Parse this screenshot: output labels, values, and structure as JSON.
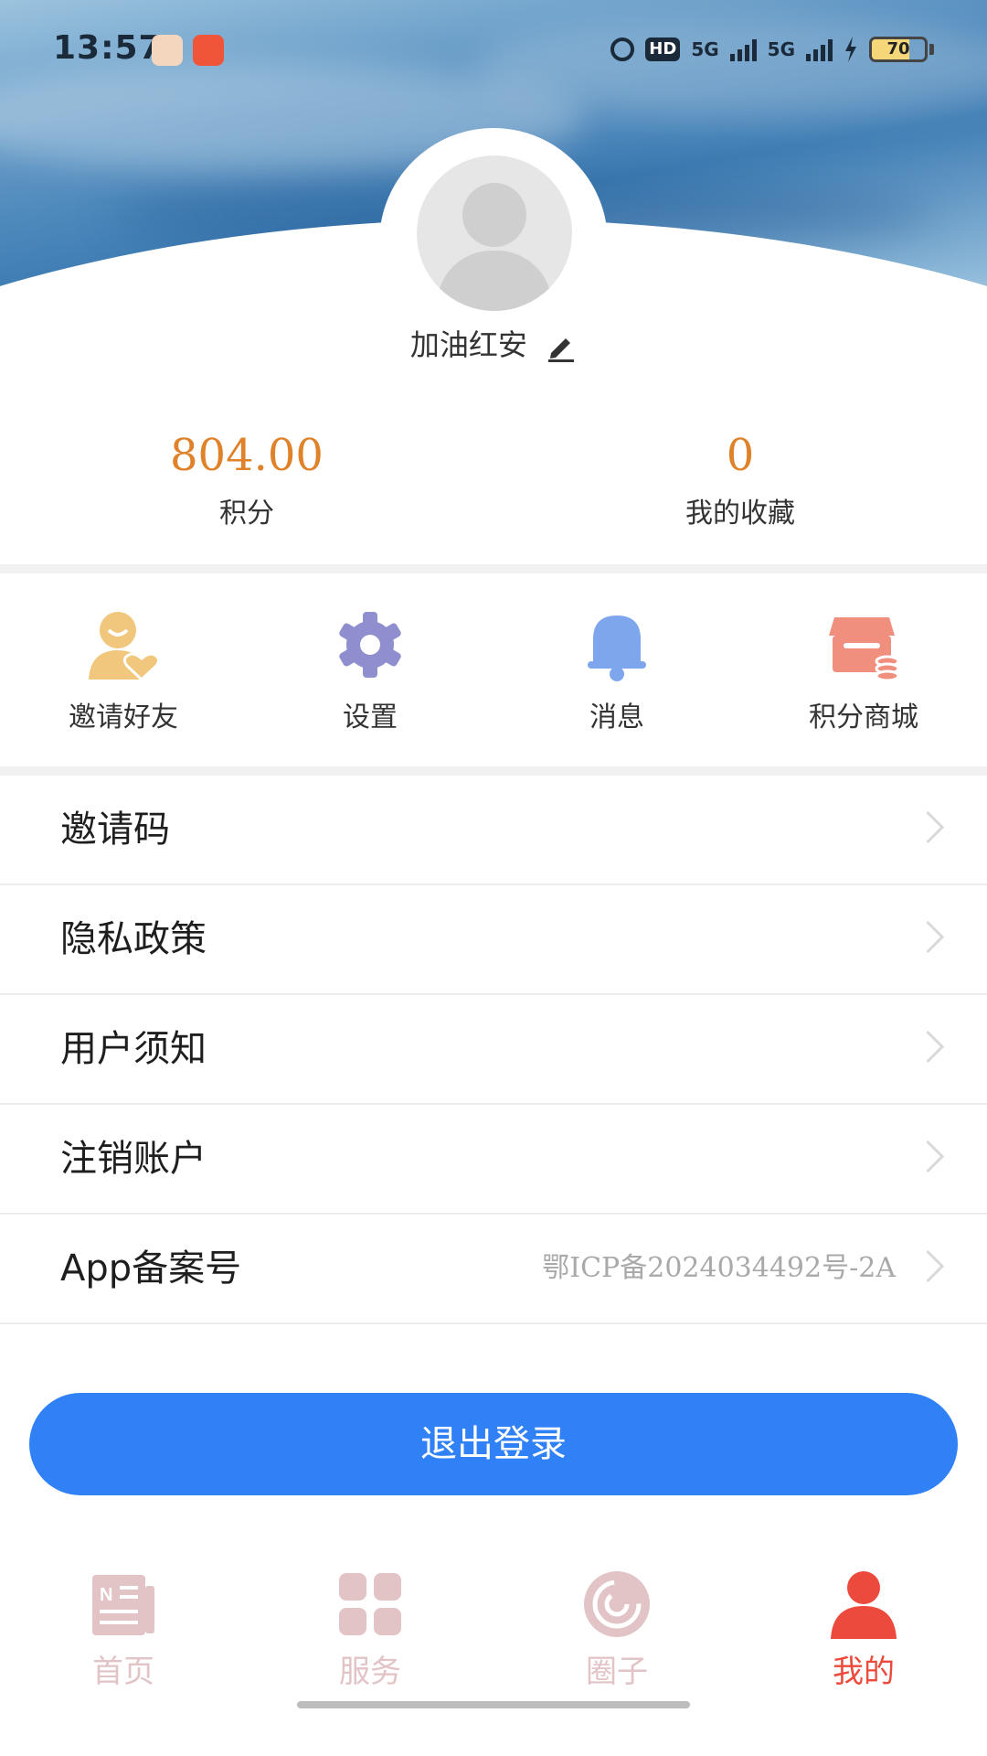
{
  "status_bar": {
    "time": "13:57",
    "network_1": "5G",
    "network_2": "5G",
    "hd": "HD",
    "battery_level": "70",
    "battery_fraction": 0.7
  },
  "profile": {
    "username": "加油红安"
  },
  "stats": {
    "points_value": "804.00",
    "points_label": "积分",
    "favorites_value": "0",
    "favorites_label": "我的收藏"
  },
  "quick_actions": [
    {
      "label": "邀请好友",
      "icon": "invite-friend-icon",
      "color": "#f0c77d"
    },
    {
      "label": "设置",
      "icon": "gear-icon",
      "color": "#8f8fcf"
    },
    {
      "label": "消息",
      "icon": "bell-icon",
      "color": "#7ea6ec"
    },
    {
      "label": "积分商城",
      "icon": "store-icon",
      "color": "#f08f7e"
    }
  ],
  "menu": [
    {
      "title": "邀请码",
      "value": ""
    },
    {
      "title": "隐私政策",
      "value": ""
    },
    {
      "title": "用户须知",
      "value": ""
    },
    {
      "title": "注销账户",
      "value": ""
    },
    {
      "title": "App备案号",
      "value": "鄂ICP备2024034492号-2A"
    }
  ],
  "logout_label": "退出登录",
  "tabs": [
    {
      "label": "首页",
      "icon": "news-icon",
      "active": false
    },
    {
      "label": "服务",
      "icon": "grid-icon",
      "active": false
    },
    {
      "label": "圈子",
      "icon": "circle-icon",
      "active": false
    },
    {
      "label": "我的",
      "icon": "user-icon",
      "active": true
    }
  ],
  "colors": {
    "accent_blue": "#3080f6",
    "points_orange": "#e0822a",
    "tab_active": "#ec4a3c",
    "tab_inactive": "#e2c3c6"
  }
}
